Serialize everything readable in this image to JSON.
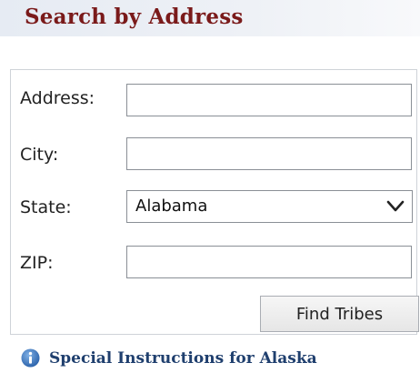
{
  "header": {
    "title": "Search by Address"
  },
  "form": {
    "address": {
      "label": "Address:",
      "value": ""
    },
    "city": {
      "label": "City:",
      "value": ""
    },
    "state": {
      "label": "State:",
      "selected": "Alabama"
    },
    "zip": {
      "label": "ZIP:",
      "value": ""
    },
    "submit_label": "Find Tribes"
  },
  "footer": {
    "alaska_link": "Special Instructions for Alaska",
    "icon": "info-icon"
  },
  "colors": {
    "title": "#7a1a1a",
    "link": "#1f3f6e",
    "info_icon": "#3b74b8"
  }
}
